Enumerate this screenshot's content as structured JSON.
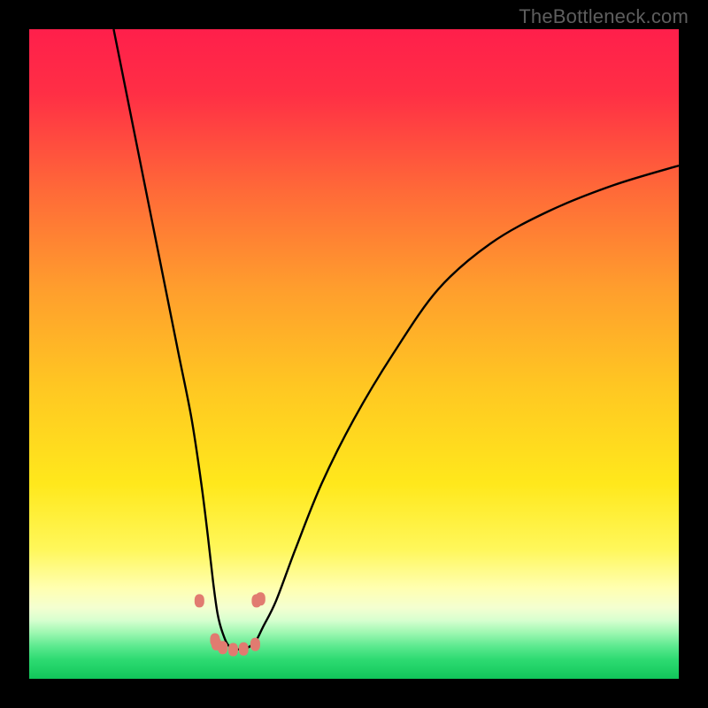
{
  "watermark": {
    "text": "TheBottleneck.com"
  },
  "chart_data": {
    "type": "line",
    "title": "",
    "xlabel": "",
    "ylabel": "",
    "xlim": [
      0,
      100
    ],
    "ylim": [
      0,
      100
    ],
    "legend": "none",
    "grid": false,
    "gradient_stops": [
      {
        "pos": 0.0,
        "color": "#ff1f4b"
      },
      {
        "pos": 0.1,
        "color": "#ff2f45"
      },
      {
        "pos": 0.25,
        "color": "#ff6a38"
      },
      {
        "pos": 0.4,
        "color": "#ff9e2d"
      },
      {
        "pos": 0.55,
        "color": "#ffc722"
      },
      {
        "pos": 0.7,
        "color": "#ffe81c"
      },
      {
        "pos": 0.8,
        "color": "#fff75a"
      },
      {
        "pos": 0.86,
        "color": "#ffffb0"
      },
      {
        "pos": 0.89,
        "color": "#f4ffd0"
      },
      {
        "pos": 0.91,
        "color": "#d7ffcf"
      },
      {
        "pos": 0.93,
        "color": "#9bf7b0"
      },
      {
        "pos": 0.95,
        "color": "#5ce98f"
      },
      {
        "pos": 0.97,
        "color": "#2edb72"
      },
      {
        "pos": 1.0,
        "color": "#11c65a"
      }
    ],
    "series": [
      {
        "name": "bottleneck-v-curve",
        "color": "#000000",
        "x": [
          13.0,
          15.0,
          17.0,
          19.0,
          21.0,
          23.0,
          25.0,
          26.5,
          27.5,
          28.3,
          29.0,
          29.8,
          30.8,
          32.5,
          34.0,
          35.0,
          36.0,
          38.0,
          41.0,
          45.0,
          50.0,
          56.0,
          63.0,
          71.0,
          80.0,
          90.0,
          100.0
        ],
        "y": [
          100.0,
          90.0,
          80.0,
          70.0,
          60.0,
          50.0,
          40.0,
          30.0,
          22.0,
          15.0,
          10.0,
          7.0,
          5.0,
          4.5,
          5.0,
          6.0,
          8.0,
          12.0,
          20.0,
          30.0,
          40.0,
          50.0,
          60.0,
          67.0,
          72.0,
          76.0,
          79.0
        ]
      }
    ],
    "scatter": {
      "name": "highlighted-points",
      "color": "#e17b70",
      "points": [
        {
          "x": 26.2,
          "y": 12.0
        },
        {
          "x": 28.6,
          "y": 6.0
        },
        {
          "x": 28.8,
          "y": 5.4
        },
        {
          "x": 29.8,
          "y": 4.8
        },
        {
          "x": 31.4,
          "y": 4.5
        },
        {
          "x": 33.0,
          "y": 4.6
        },
        {
          "x": 34.8,
          "y": 5.3
        },
        {
          "x": 35.0,
          "y": 12.0
        },
        {
          "x": 35.6,
          "y": 12.3
        }
      ]
    }
  }
}
